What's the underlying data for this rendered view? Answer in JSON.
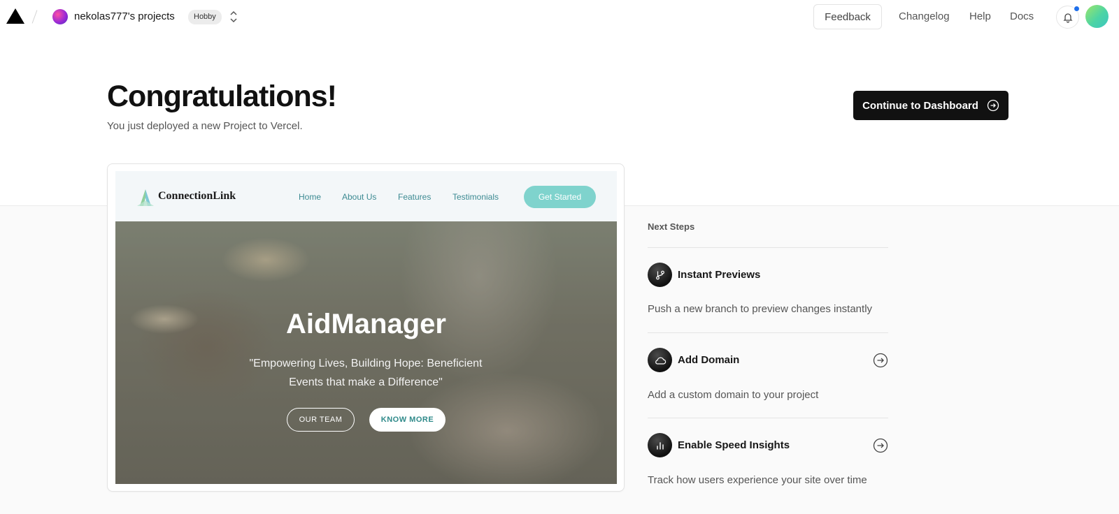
{
  "topnav": {
    "project_name": "nekolas777's projects",
    "plan_badge": "Hobby",
    "feedback_label": "Feedback",
    "links": [
      "Changelog",
      "Help",
      "Docs"
    ]
  },
  "hero": {
    "title": "Congratulations!",
    "subtitle": "You just deployed a new Project to Vercel.",
    "continue_label": "Continue to Dashboard"
  },
  "preview": {
    "brand": "ConnectionLink",
    "nav": [
      "Home",
      "About Us",
      "Features",
      "Testimonials"
    ],
    "cta": "Get Started",
    "hero_title": "AidManager",
    "hero_quote": "\"Empowering Lives, Building Hope: Beneficient Events that make a Difference\"",
    "btn_team": "OUR TEAM",
    "btn_more": "KNOW MORE"
  },
  "next_steps": {
    "title": "Next Steps",
    "items": [
      {
        "title": "Instant Previews",
        "desc": "Push a new branch to preview changes instantly",
        "icon": "git-branch-icon"
      },
      {
        "title": "Add Domain",
        "desc": "Add a custom domain to your project",
        "icon": "cloud-icon"
      },
      {
        "title": "Enable Speed Insights",
        "desc": "Track how users experience your site over time",
        "icon": "bar-chart-icon"
      }
    ]
  },
  "colors": {
    "accent_dark": "#111111",
    "preview_teal": "#7fd3cd",
    "notification_dot": "#1f6feb"
  }
}
